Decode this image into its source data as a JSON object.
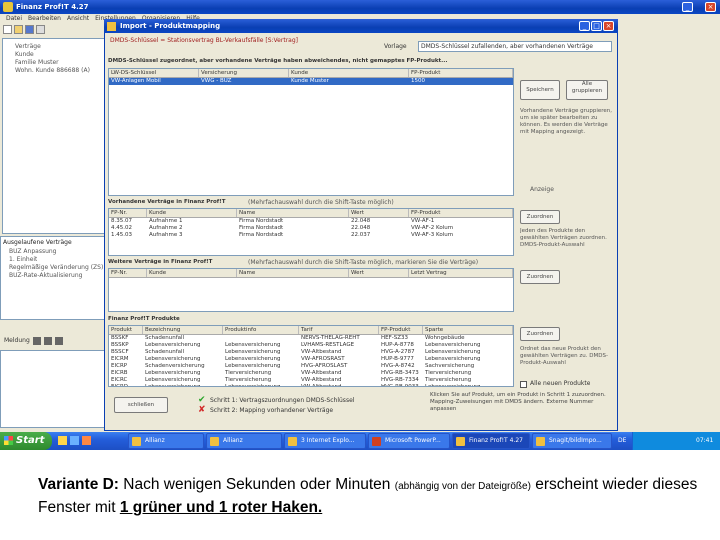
{
  "app": {
    "title": "Finanz Prof!T 4.27",
    "menu": [
      "Datei",
      "Bearbeiten",
      "Ansicht",
      "Einstellungen",
      "Organisieren",
      "Hilfe"
    ]
  },
  "tree": {
    "items": [
      "Verträge",
      "Kunde",
      "Familie Muster",
      "Wohn. Kunde 886688 (A)"
    ]
  },
  "lower_tree": {
    "title": "Ausgelaufene Verträge",
    "items": [
      "BUZ Anpassung",
      "1. Einheit",
      "Regelmäßige Veränderung (ZS)",
      "BUZ-Rate-Aktualisierung"
    ]
  },
  "lower_toolbar": {
    "label": "Meldung"
  },
  "dialog": {
    "title": "Import - Produktmapping",
    "top_text": "DMDS-Schlüssel = Stationsvertrag BL-Verkaufsfälle [S:Vertrag]",
    "combo_label": "Vorlage",
    "combo_value": "DMDS-Schlüssel zufallenden, aber vorhandenen Verträge",
    "section1_title": "DMDS-Schlüssel zugeordnet, aber vorhandene Verträge haben abweichendes, nicht gemapptes FP-Produkt...",
    "grid1": {
      "headers": [
        "LW-DS-Schlüssel",
        "Versicherung",
        "Kunde",
        "FP-Produkt"
      ],
      "rows": [
        [
          "VW-Anlagen Mobil",
          "VWG - BUZ",
          "Kunde Muster",
          "1500"
        ]
      ]
    },
    "buttons_right1": [
      "Speichern",
      "Alle gruppieren"
    ],
    "note_right1": "Vorhandene Verträge gruppieren, um sie später bearbeiten zu können. Es werden die Verträge mit Mapping angezeigt.",
    "note_right1b": "Anzeige",
    "section2_title": "Vorhandene Verträge in Finanz Prof!T",
    "section2_hint": "(Mehrfachauswahl durch die Shift-Taste möglich)",
    "grid2": {
      "headers": [
        "FP-Nr.",
        "Kunde",
        "Name",
        "Wert",
        "FP-Produkt"
      ],
      "rows": [
        [
          "8.35.07",
          "Aufnahme 1",
          "Firma Nordstadt",
          "22.048",
          "VW-AF-1"
        ],
        [
          "4.45.02",
          "Aufnahme 2",
          "Firma Nordstadt",
          "22.048",
          "VW-AF-2 Kolum"
        ],
        [
          "1.45.03",
          "Aufnahme 3",
          "Firma Nordstadt",
          "22.037",
          "VW-AF-3 Kolum"
        ]
      ]
    },
    "button_right2": "Zuordnen",
    "note_right2": "Jeden des Produkte den gewählten Verträgen zuordnen. DMDS-Produkt-Auswahl",
    "section3_title": "Weitere Verträge in Finanz Prof!T",
    "section3_hint": "(Mehrfachauswahl durch die Shift-Taste möglich, markieren Sie die Verträge)",
    "grid3": {
      "headers": [
        "FP-Nr.",
        "Kunde",
        "Name",
        "Wert",
        "Letzt Vertrag"
      ],
      "rows": []
    },
    "button_right3": "Zuordnen",
    "section4_title": "Finanz Prof!T Produkte",
    "grid4": {
      "headers": [
        "Produkt",
        "Bezeichnung",
        "Produktinfo",
        "Tarif",
        "FP-Produkt",
        "Sparte"
      ],
      "rows": [
        [
          "BSSKF",
          "Schadenunfall",
          "",
          "NERVS-THELAG-REHT",
          "HEF-SZ33",
          "Wohngebäude"
        ],
        [
          "BSSKP",
          "Lebensversicherung",
          "Lebensversicherung",
          "LVHAMS-RESTLAGE",
          "HUP-A-8778",
          "Lebensversicherung"
        ],
        [
          "BSSCF",
          "Schadenunfall",
          "Lebensversicherung",
          "VW-Altbestand",
          "HVG-A-2787",
          "Lebensversicherung"
        ],
        [
          "EICRM",
          "Lebensversicherung",
          "Lebensversicherung",
          "VW-AFROSRAST",
          "HUP-B-9777",
          "Lebensversicherung"
        ],
        [
          "EICRP",
          "Schadenversicherung",
          "Lebensversicherung",
          "HVG-AFROSLAST",
          "HVG-A-8742",
          "Sachversicherung"
        ],
        [
          "EICRB",
          "Lebensversicherung",
          "Tierversicherung",
          "VW-Altbestand",
          "HVG-RB-3473",
          "Tierversicherung"
        ],
        [
          "EICRC",
          "Lebensversicherung",
          "Tierversicherung",
          "VW-Altbestand",
          "HVG-RB-7334",
          "Tierversicherung"
        ],
        [
          "EICRD",
          "Lebensversicherung",
          "Lebensversicherung",
          "VW-Altbestand",
          "HVG-RB-9033",
          "Lebensversicherung"
        ]
      ]
    },
    "button_right4": "Zuordnen",
    "note_right4": "Ordnet das neue Produkt den gewählten Verträgen zu. DMDS-Produkt-Auswahl",
    "checkbox_label": "Alle neuen Produkte",
    "close_button": "schließen",
    "step1": "Schritt 1: Vertragszuordnungen DMDS-Schlüssel",
    "step2": "Schritt 2: Mapping vorhandener Verträge",
    "bottom_note": "Klicken Sie auf Produkt, um ein Produkt in Schritt 1 zuzuordnen. Mapping-Zuweisungen mit DMDS ändern. Externe Nummer anpassen"
  },
  "taskbar": {
    "start": "Start",
    "buttons": [
      "Allianz",
      "Allianz",
      "3 Internet Explo...",
      "Microsoft PowerP...",
      "Finanz Prof!T 4.27",
      "Snagit/bildImpo..."
    ],
    "lang": "DE",
    "time": "07:41"
  },
  "caption": {
    "lead": "Variante D:",
    "part1": " Nach wenigen Sekunden oder Minuten ",
    "small": "(abhängig von der Dateigröße)",
    "part2": " erscheint wieder dieses Fenster mit ",
    "underlined": "1 grüner und 1 roter Haken."
  },
  "colors": {
    "xp_blue": "#0a3fb3",
    "taskbar": "#245edb",
    "start_green": "#3c9a3c",
    "check_green": "#2aa52a",
    "cross_red": "#d22a2a"
  }
}
